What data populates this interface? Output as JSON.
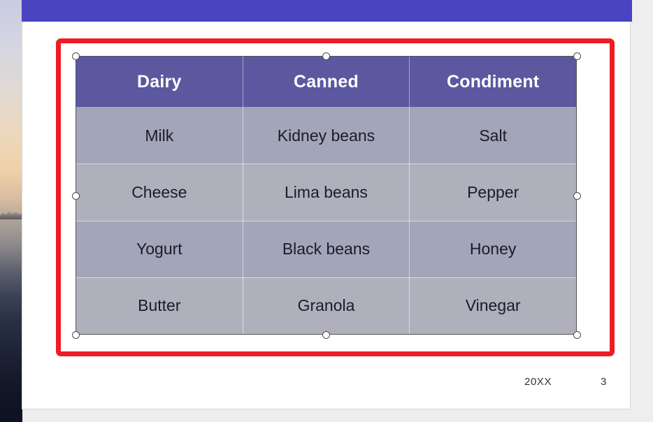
{
  "window": {
    "title_bar_color": "#4a44c2",
    "canvas_color": "#ffffff",
    "app_background_color": "#eeeeee"
  },
  "annotation": {
    "name": "red-highlight-rectangle",
    "color": "#ee1c24"
  },
  "table": {
    "header_color": "#5b58a0",
    "header_text_color": "#ffffff",
    "row_dark_color": "#a3a5b8",
    "row_light_color": "#b0b0bd",
    "body_text_color": "#1b1b2b",
    "headers": [
      "Dairy",
      "Canned",
      "Condiment"
    ],
    "rows": [
      [
        "Milk",
        "Kidney beans",
        "Salt"
      ],
      [
        "Cheese",
        "Lima beans",
        "Pepper"
      ],
      [
        "Yogurt",
        "Black beans",
        "Honey"
      ],
      [
        "Butter",
        "Granola",
        "Vinegar"
      ]
    ]
  },
  "footer": {
    "year": "20XX",
    "page_number": "3"
  },
  "handles": [
    {
      "name": "handle-top-left"
    },
    {
      "name": "handle-top-center"
    },
    {
      "name": "handle-top-right"
    },
    {
      "name": "handle-middle-left"
    },
    {
      "name": "handle-middle-right"
    },
    {
      "name": "handle-bottom-left"
    },
    {
      "name": "handle-bottom-center"
    },
    {
      "name": "handle-bottom-right"
    }
  ]
}
